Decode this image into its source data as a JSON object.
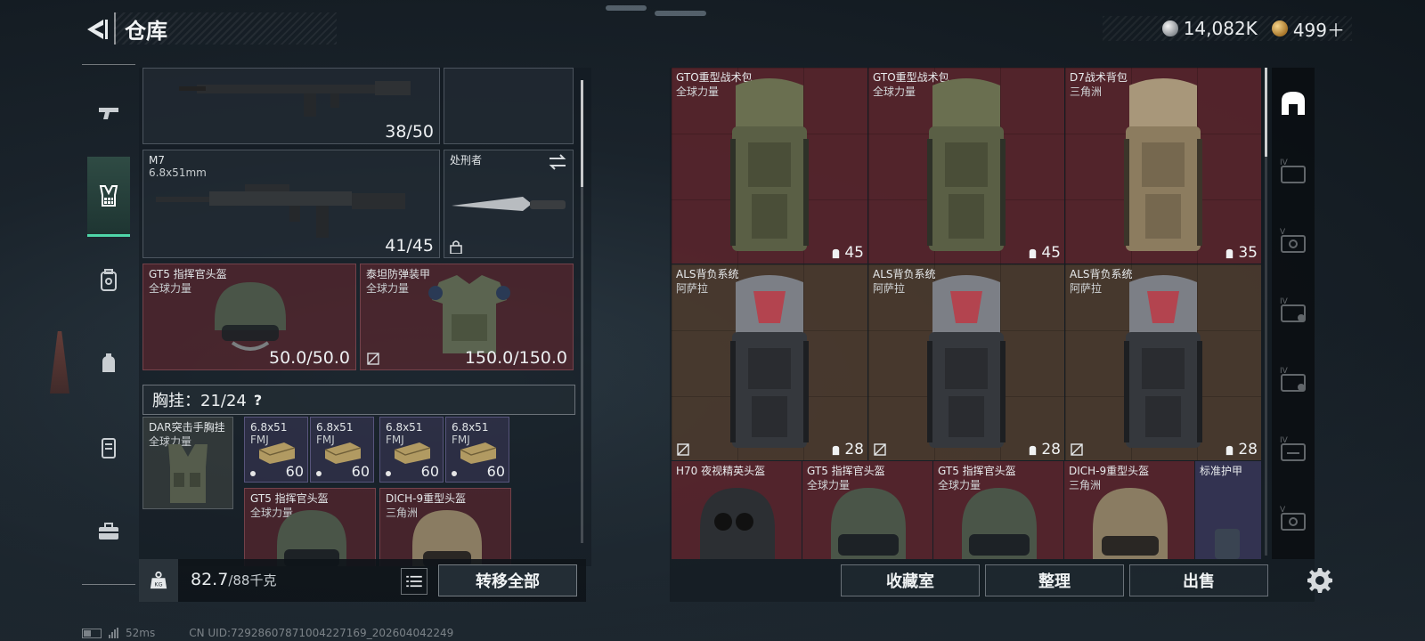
{
  "header": {
    "title": "仓库",
    "currencies": [
      {
        "icon": "silver-coin-icon",
        "value": "14,082K"
      },
      {
        "icon": "gold-coin-icon",
        "value": "499＋"
      }
    ]
  },
  "left_tabs": [
    {
      "name": "tab-weapons",
      "icon": "pistol-icon",
      "active": false
    },
    {
      "name": "tab-chest-rig",
      "icon": "chest-rig-icon",
      "active": true
    },
    {
      "name": "tab-backpack",
      "icon": "backpack-icon",
      "active": false
    },
    {
      "name": "tab-pouch",
      "icon": "pouch-icon",
      "active": false
    },
    {
      "name": "tab-case",
      "icon": "case-icon",
      "active": false
    },
    {
      "name": "tab-toolbox",
      "icon": "toolbox-icon",
      "active": false
    }
  ],
  "loadout": {
    "primary_weapon": {
      "ammo": "38/50"
    },
    "secondary_weapon": {
      "name": "M7",
      "caliber": "6.8x51mm",
      "ammo": "41/45"
    },
    "melee": {
      "name": "处刑者"
    },
    "helmet": {
      "name": "GT5 指挥官头盔",
      "faction": "全球力量",
      "durability": "50.0/50.0"
    },
    "armor": {
      "name": "泰坦防弹装甲",
      "faction": "全球力量",
      "durability": "150.0/150.0"
    },
    "chest_rig_label": "胸挂：21/24",
    "help": "?",
    "rig_item": {
      "name": "DAR突击手胸挂",
      "faction": "全球力量"
    },
    "ammo_slots": [
      {
        "name": "6.8x51",
        "type": "FMJ",
        "count": "60"
      },
      {
        "name": "6.8x51",
        "type": "FMJ",
        "count": "60"
      },
      {
        "name": "6.8x51",
        "type": "FMJ",
        "count": "60"
      },
      {
        "name": "6.8x51",
        "type": "FMJ",
        "count": "60"
      }
    ],
    "rig_helmets": [
      {
        "name": "GT5 指挥官头盔",
        "faction": "全球力量"
      },
      {
        "name": "DICH-9重型头盔",
        "faction": "三角洲"
      }
    ]
  },
  "left_bottom": {
    "weight_value": "82.7",
    "weight_max": "/88千克",
    "transfer_all": "转移全部"
  },
  "storage": {
    "backpacks_row1": [
      {
        "name": "GTO重型战术包",
        "faction": "全球力量",
        "capacity": "45",
        "color": "#6a6f50"
      },
      {
        "name": "GTO重型战术包",
        "faction": "全球力量",
        "capacity": "45",
        "color": "#6a6f50"
      },
      {
        "name": "D7战术背包",
        "faction": "三角洲",
        "capacity": "35",
        "color": "#9c8b6c"
      }
    ],
    "backpacks_row2": [
      {
        "name": "ALS背负系统",
        "faction": "阿萨拉",
        "capacity": "28",
        "color": "#3a3d42"
      },
      {
        "name": "ALS背负系统",
        "faction": "阿萨拉",
        "capacity": "28",
        "color": "#3a3d42"
      },
      {
        "name": "ALS背负系统",
        "faction": "阿萨拉",
        "capacity": "28",
        "color": "#3a3d42"
      }
    ],
    "helmets_row": [
      {
        "name": "H70 夜视精英头盔",
        "faction": ""
      },
      {
        "name": "GT5 指挥官头盔",
        "faction": "全球力量"
      },
      {
        "name": "GT5 指挥官头盔",
        "faction": "全球力量"
      },
      {
        "name": "DICH-9重型头盔",
        "faction": "三角洲"
      },
      {
        "name": "标准护甲",
        "faction": ""
      }
    ]
  },
  "right_sidebar": [
    {
      "name": "storage-home-button",
      "icon": "storage-home-icon"
    },
    {
      "name": "expansion-case-1-button",
      "icon": "expansion-case-icon"
    },
    {
      "name": "expansion-case-2-button",
      "icon": "expansion-case-icon"
    },
    {
      "name": "expansion-case-3-button",
      "icon": "expansion-case-icon"
    },
    {
      "name": "expansion-case-4-button",
      "icon": "expansion-case-icon"
    },
    {
      "name": "expansion-case-5-button",
      "icon": "expansion-case-icon"
    },
    {
      "name": "expansion-case-6-button",
      "icon": "expansion-case-icon"
    }
  ],
  "actions": {
    "collection": "收藏室",
    "sort": "整理",
    "sell": "出售"
  },
  "status": {
    "ping": "52ms",
    "uid": "CN UID:72928607871004227169_202604042249"
  },
  "colors": {
    "accent": "#4fd6a8",
    "slot_red": "#6e2830",
    "slot_brown": "#523e30",
    "slot_purple": "#3a385c"
  }
}
